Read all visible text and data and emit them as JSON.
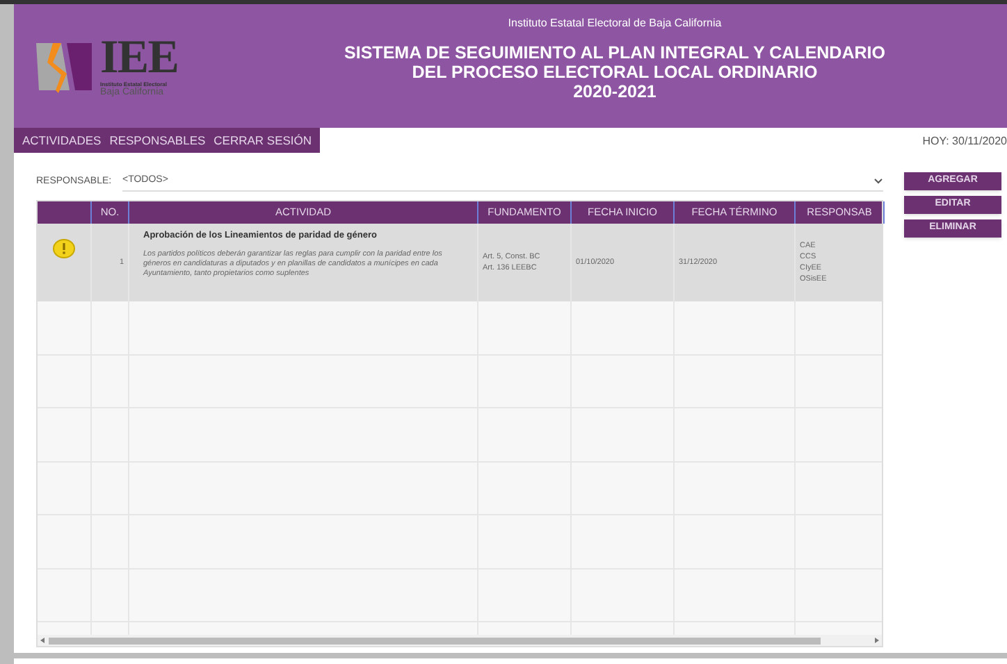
{
  "header": {
    "institution": "Instituto Estatal Electoral de Baja California",
    "logo": {
      "acronym": "IEE",
      "subtitle": "Instituto Estatal Electoral",
      "region": "Baja California"
    },
    "title_lines": [
      "SISTEMA DE SEGUIMIENTO AL PLAN INTEGRAL Y CALENDARIO",
      "DEL PROCESO ELECTORAL LOCAL ORDINARIO",
      "2020-2021"
    ]
  },
  "nav": [
    {
      "label": "ACTIVIDADES"
    },
    {
      "label": "RESPONSABLES"
    },
    {
      "label": "CERRAR SESIÓN"
    }
  ],
  "today": "HOY: 30/11/2020",
  "filter": {
    "label": "RESPONSABLE:",
    "value": "<TODOS>"
  },
  "table": {
    "columns": [
      "",
      "NO.",
      "ACTIVIDAD",
      "FUNDAMENTO",
      "FECHA INICIO",
      "FECHA TÉRMINO",
      "RESPONSAB"
    ],
    "rows": [
      {
        "alert": true,
        "no": "1",
        "title": "Aprobación de los Lineamientos de paridad de género",
        "description": "Los partidos políticos deberán garantizar las reglas para cumplir con la paridad entre los géneros en candidaturas a diputados y en planillas de candidatos a munícipes en cada Ayuntamiento, tanto propietarios como suplentes",
        "fundamento": [
          "Art. 5, Const. BC",
          "Art. 136 LEEBC"
        ],
        "fecha_inicio": "01/10/2020",
        "fecha_termino": "31/12/2020",
        "responsables": [
          "CAE",
          "CCS",
          "CIyEE",
          "OSisEE"
        ]
      }
    ]
  },
  "actions": [
    "AGREGAR",
    "EDITAR",
    "ELIMINAR"
  ]
}
